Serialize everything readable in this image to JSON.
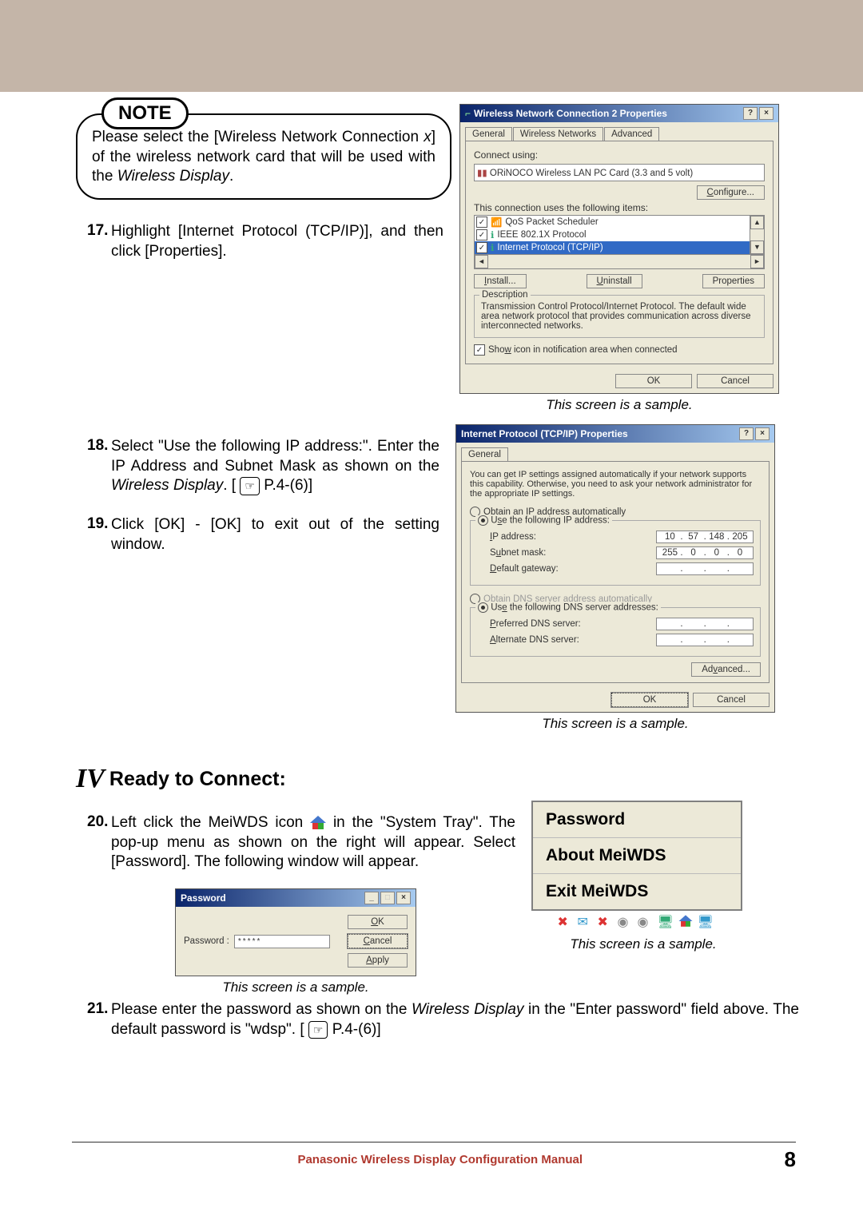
{
  "note": {
    "label": "NOTE",
    "text_before_x": "Please select the [Wireless Network Connection ",
    "x": "x",
    "text_after_x": "] of the wireless network card that will be used with the ",
    "italic_end": "Wireless Display",
    "text_end": "."
  },
  "step17": {
    "num": "17.",
    "text": "Highlight [Internet Protocol (TCP/IP)], and then click [Properties]."
  },
  "dialog1": {
    "title": "Wireless Network Connection 2 Properties",
    "tab_general": "General",
    "tab_wireless": "Wireless Networks",
    "tab_advanced": "Advanced",
    "connect_using_label": "Connect using:",
    "adapter": "ORiNOCO Wireless LAN PC Card (3.3 and 5 volt)",
    "configure": "Configure...",
    "items_label": "This connection uses the following items:",
    "item_qos": "QoS Packet Scheduler",
    "item_ieee": "IEEE 802.1X Protocol",
    "item_tcpip": "Internet Protocol (TCP/IP)",
    "install": "Install...",
    "uninstall": "Uninstall",
    "properties": "Properties",
    "desc_label": "Description",
    "desc_text": "Transmission Control Protocol/Internet Protocol. The default wide area network protocol that provides communication across diverse interconnected networks.",
    "show_icon": "Show icon in notification area when connected",
    "ok": "OK",
    "cancel": "Cancel"
  },
  "sample_label": "This screen is a sample.",
  "step18": {
    "num": "18.",
    "text_a": "Select \"Use the following IP address:\". Enter the IP Address and Subnet Mask as shown on the ",
    "italic": "Wireless Display",
    "text_b": ". [",
    "ref": "P.4-(6)]"
  },
  "step19": {
    "num": "19.",
    "text": "Click [OK] - [OK] to exit out of the setting window."
  },
  "dialog2": {
    "title": "Internet Protocol (TCP/IP) Properties",
    "tab_general": "General",
    "intro": "You can get IP settings assigned automatically if your network supports this capability. Otherwise, you need to ask your network administrator for the appropriate IP settings.",
    "radio_auto": "Obtain an IP address automatically",
    "radio_use": "Use the following IP address:",
    "ip_label": "IP address:",
    "ip": [
      "10",
      "57",
      "148",
      "205"
    ],
    "subnet_label": "Subnet mask:",
    "subnet": [
      "255",
      "0",
      "0",
      "0"
    ],
    "gateway_label": "Default gateway:",
    "radio_dns_auto": "Obtain DNS server address automatically",
    "radio_dns_use": "Use the following DNS server addresses:",
    "preferred_dns": "Preferred DNS server:",
    "alternate_dns": "Alternate DNS server:",
    "advanced": "Advanced...",
    "ok": "OK",
    "cancel": "Cancel"
  },
  "section4": {
    "roman": "IV",
    "title": "Ready to Connect:"
  },
  "step20": {
    "num": "20.",
    "text_a": "Left click the MeiWDS icon ",
    "text_b": " in the \"System Tray\". The pop-up menu as shown on the right will appear. Select [Password]. The following window will appear."
  },
  "popup": {
    "password": "Password",
    "about": "About MeiWDS",
    "exit": "Exit MeiWDS"
  },
  "pwd_dialog": {
    "title": "Password",
    "label": "Password :",
    "value": "*****",
    "ok": "OK",
    "cancel": "Cancel",
    "apply": "Apply"
  },
  "step21": {
    "num": "21.",
    "text_a": "Please enter the password as shown on the ",
    "italic": "Wireless Display",
    "text_b": " in the \"Enter password\" field above. The default password is \"wdsp\". [",
    "ref": "P.4-(6)]"
  },
  "footer": {
    "text": "Panasonic Wireless Display Configuration Manual",
    "page": "8"
  }
}
